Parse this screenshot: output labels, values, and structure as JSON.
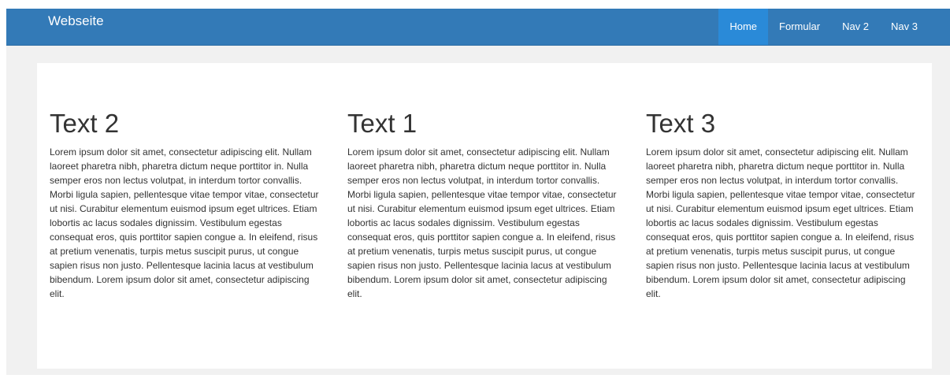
{
  "navbar": {
    "brand": "Webseite",
    "items": [
      {
        "label": "Home",
        "active": true
      },
      {
        "label": "Formular",
        "active": false
      },
      {
        "label": "Nav 2",
        "active": false
      },
      {
        "label": "Nav 3",
        "active": false
      }
    ]
  },
  "colors": {
    "navbar": "#337ab7",
    "nav_active": "#2a8ad8",
    "page_background": "#f1f1f1",
    "panel": "#ffffff",
    "text": "#333333"
  },
  "main": {
    "columns": [
      {
        "heading": "Text 2",
        "body": "Lorem ipsum dolor sit amet, consectetur adipiscing elit. Nullam laoreet pharetra nibh, pharetra dictum neque porttitor in. Nulla semper eros non lectus volutpat, in interdum tortor convallis. Morbi ligula sapien, pellentesque vitae tempor vitae, consectetur ut nisi. Curabitur elementum euismod ipsum eget ultrices. Etiam lobortis ac lacus sodales dignissim. Vestibulum egestas consequat eros, quis porttitor sapien congue a. In eleifend, risus at pretium venenatis, turpis metus suscipit purus, ut congue sapien risus non justo. Pellentesque lacinia lacus at vestibulum bibendum. Lorem ipsum dolor sit amet, consectetur adipiscing elit."
      },
      {
        "heading": "Text 1",
        "body": "Lorem ipsum dolor sit amet, consectetur adipiscing elit. Nullam laoreet pharetra nibh, pharetra dictum neque porttitor in. Nulla semper eros non lectus volutpat, in interdum tortor convallis. Morbi ligula sapien, pellentesque vitae tempor vitae, consectetur ut nisi. Curabitur elementum euismod ipsum eget ultrices. Etiam lobortis ac lacus sodales dignissim. Vestibulum egestas consequat eros, quis porttitor sapien congue a. In eleifend, risus at pretium venenatis, turpis metus suscipit purus, ut congue sapien risus non justo. Pellentesque lacinia lacus at vestibulum bibendum. Lorem ipsum dolor sit amet, consectetur adipiscing elit."
      },
      {
        "heading": "Text 3",
        "body": "Lorem ipsum dolor sit amet, consectetur adipiscing elit. Nullam laoreet pharetra nibh, pharetra dictum neque porttitor in. Nulla semper eros non lectus volutpat, in interdum tortor convallis. Morbi ligula sapien, pellentesque vitae tempor vitae, consectetur ut nisi. Curabitur elementum euismod ipsum eget ultrices. Etiam lobortis ac lacus sodales dignissim. Vestibulum egestas consequat eros, quis porttitor sapien congue a. In eleifend, risus at pretium venenatis, turpis metus suscipit purus, ut congue sapien risus non justo. Pellentesque lacinia lacus at vestibulum bibendum. Lorem ipsum dolor sit amet, consectetur adipiscing elit."
      }
    ]
  }
}
